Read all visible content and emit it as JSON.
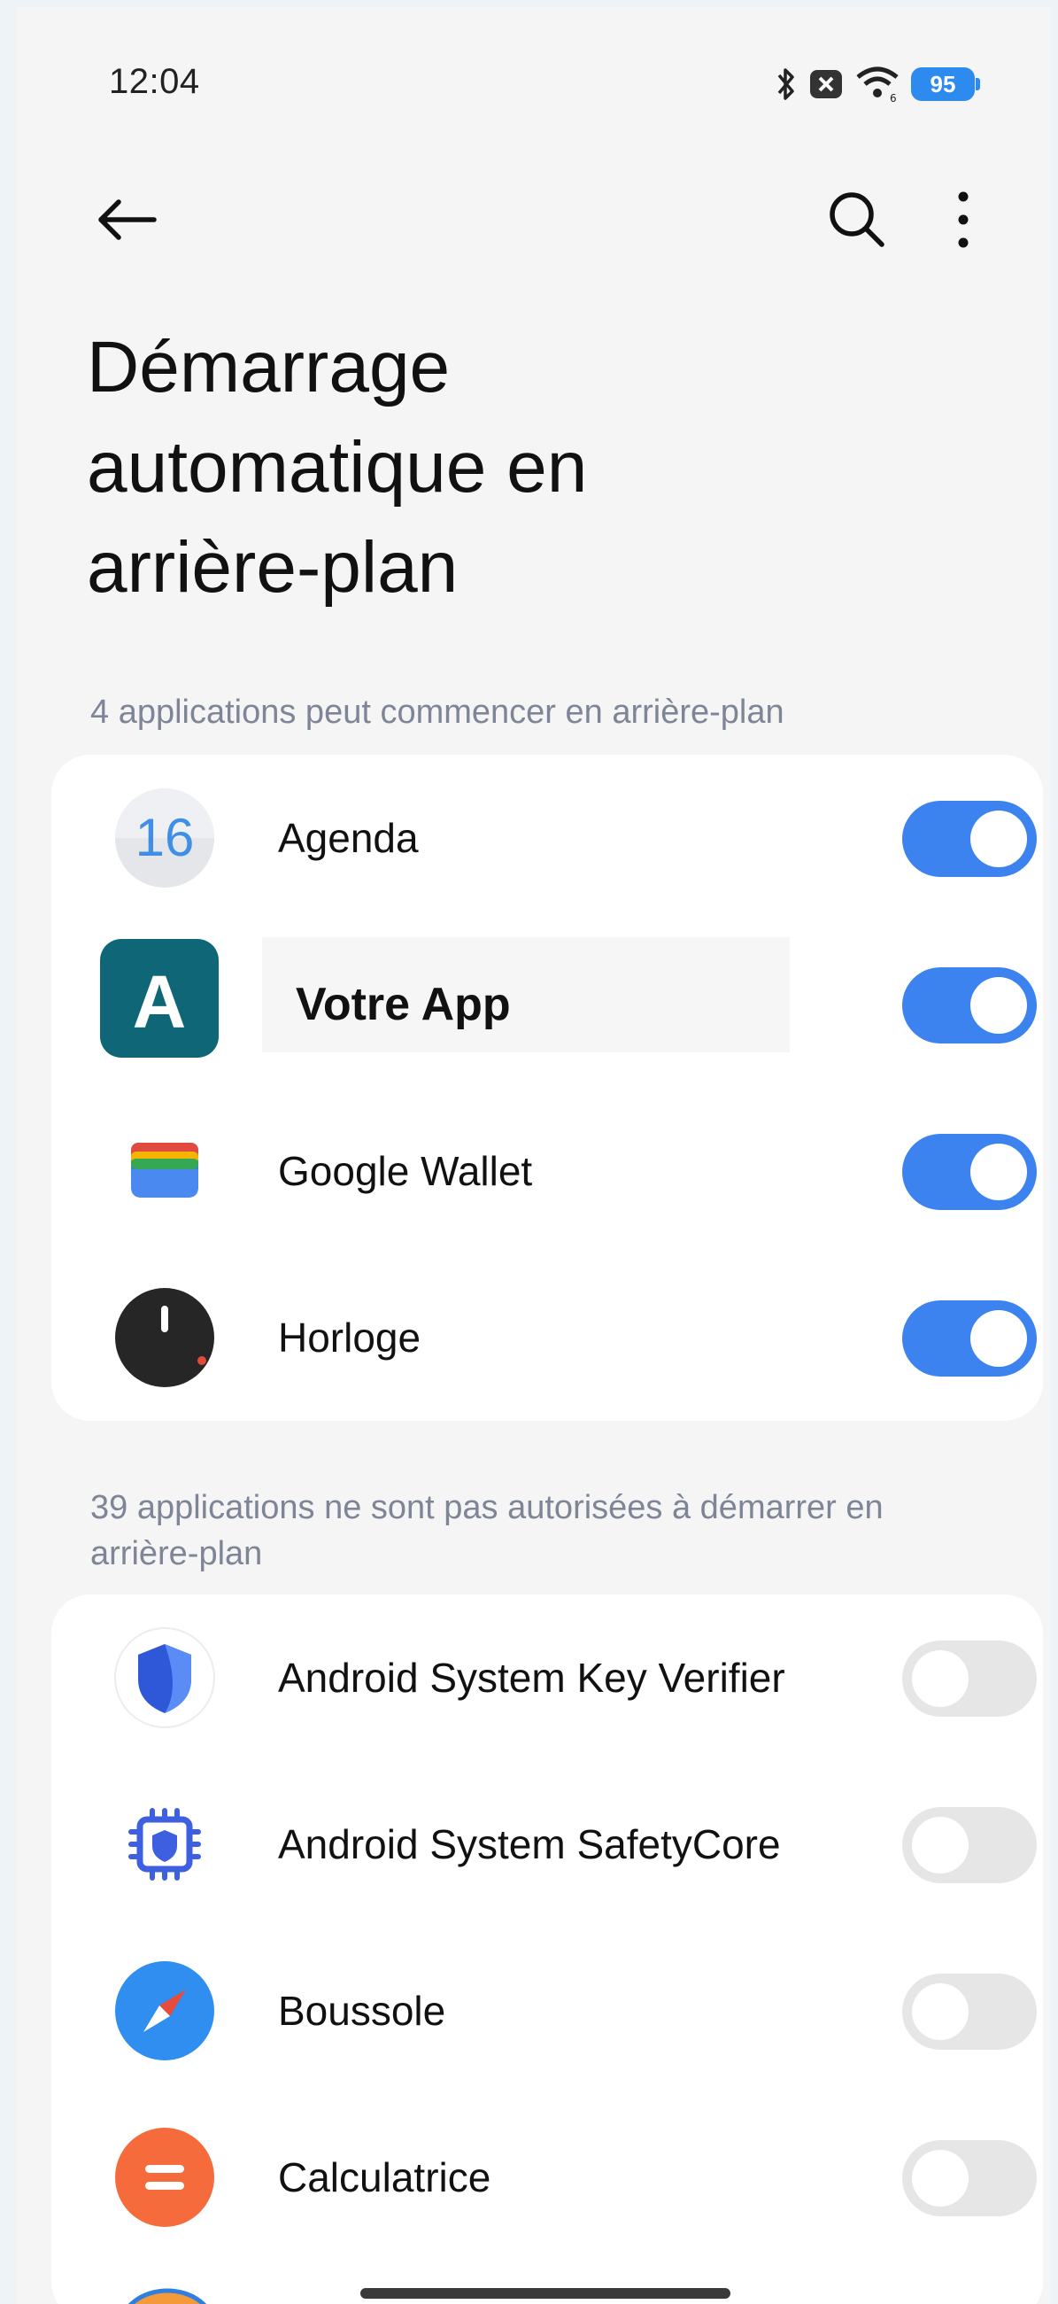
{
  "status_bar": {
    "time": "12:04",
    "battery": "95",
    "icons": [
      "bluetooth-icon",
      "close-box-icon",
      "wifi-icon",
      "battery-icon"
    ]
  },
  "app_bar": {
    "back_icon": "arrow-left-icon",
    "search_icon": "search-icon",
    "more_icon": "more-vertical-icon"
  },
  "page": {
    "title_lines": [
      "Démarrage",
      "automatique en",
      "arrière-plan"
    ]
  },
  "allowed_section": {
    "caption": "4 applications peut commencer en arrière-plan",
    "apps": [
      {
        "label": "Agenda",
        "icon": "calendar-icon",
        "enabled": true
      },
      {
        "label": "Votre App",
        "icon": "app-a-icon",
        "enabled": true
      },
      {
        "label": "Google Wallet",
        "icon": "wallet-icon",
        "enabled": true
      },
      {
        "label": "Horloge",
        "icon": "clock-icon",
        "enabled": true
      }
    ]
  },
  "blocked_section": {
    "caption": "39 applications ne sont pas autorisées à démarrer en arrière-plan",
    "apps": [
      {
        "label": "Android System Key Verifier",
        "icon": "shield-icon",
        "enabled": false
      },
      {
        "label": "Android System SafetyCore",
        "icon": "chip-shield-icon",
        "enabled": false
      },
      {
        "label": "Boussole",
        "icon": "compass-icon",
        "enabled": false
      },
      {
        "label": "Calculatrice",
        "icon": "calculator-icon",
        "enabled": false
      }
    ]
  },
  "colors": {
    "accent": "#3d83f0",
    "toggle_off": "#e6e6e6",
    "caption": "#7e8596",
    "background": "#f5f5f5"
  }
}
